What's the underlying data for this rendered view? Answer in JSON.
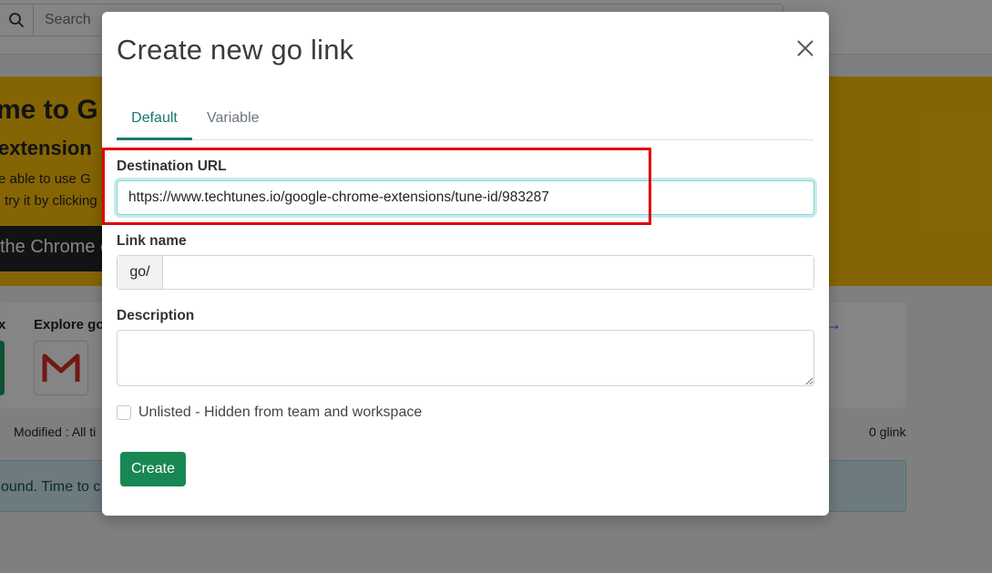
{
  "background": {
    "search_placeholder": "Search",
    "banner": {
      "heading": "me to G",
      "subheading": " extension",
      "line1": "e able to use G",
      "line2": "try it by clicking",
      "button_label": "the Chrome e"
    },
    "explore": {
      "x_label": "x",
      "label": "Explore go",
      "arrow": "→",
      "gmail_letter": "M"
    },
    "modified_label": "Modified : All ti",
    "glink_count": "0 glink",
    "found_text": "ound. Time to c"
  },
  "modal": {
    "title": "Create new go link",
    "tabs": [
      {
        "label": "Default",
        "active": true
      },
      {
        "label": "Variable",
        "active": false
      }
    ],
    "destination": {
      "label": "Destination URL",
      "value": "https://www.techtunes.io/google-chrome-extensions/tune-id/983287"
    },
    "link_name": {
      "label": "Link name",
      "prefix": "go/",
      "value": ""
    },
    "description": {
      "label": "Description",
      "value": ""
    },
    "unlisted": {
      "label": "Unlisted - Hidden from team and workspace",
      "checked": false
    },
    "create_label": "Create"
  },
  "colors": {
    "accent": "#157a6e",
    "create_button": "#198754",
    "banner": "#ffc107",
    "highlight": "#e00000"
  }
}
